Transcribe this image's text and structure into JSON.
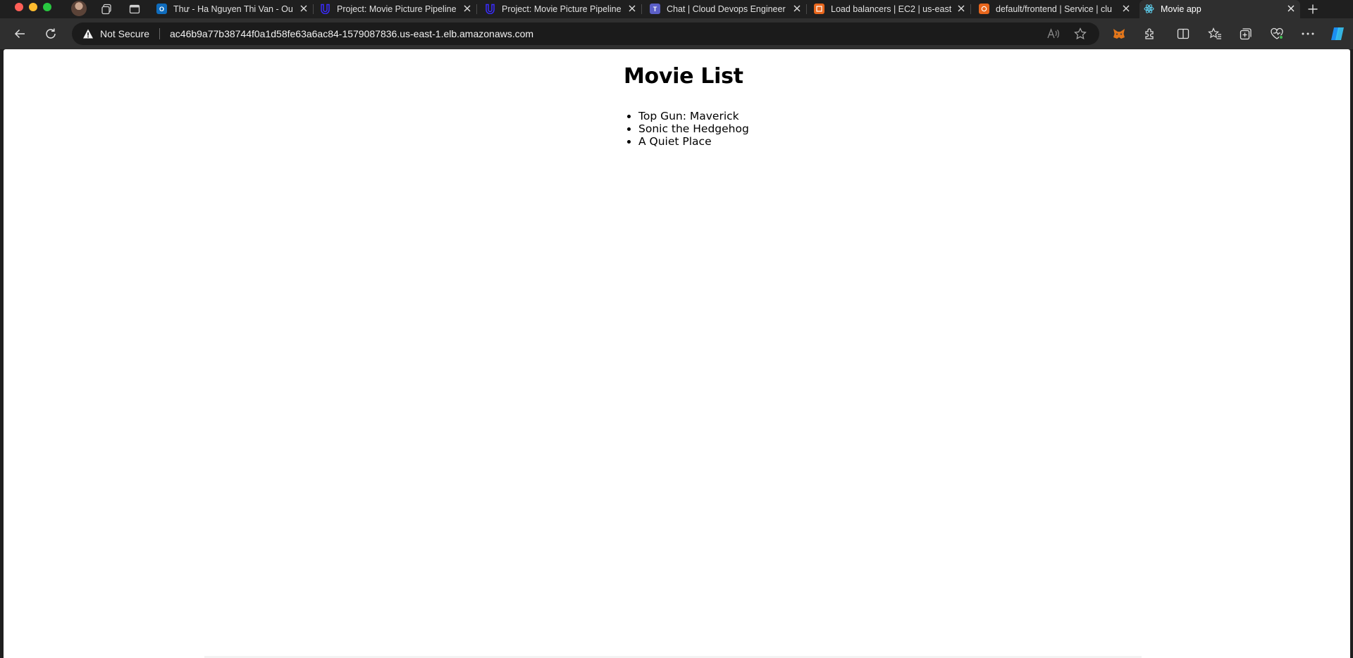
{
  "browser": {
    "tabs": [
      {
        "title": "Thư - Ha Nguyen Thi Van - Ou",
        "favicon": "outlook-icon",
        "color": "#0f6cbd"
      },
      {
        "title": "Project: Movie Picture Pipeline",
        "favicon": "udacity-icon",
        "color": "#2015ff"
      },
      {
        "title": "Project: Movie Picture Pipeline",
        "favicon": "udacity-icon",
        "color": "#2015ff"
      },
      {
        "title": "Chat | Cloud Devops Engineer",
        "favicon": "teams-icon",
        "color": "#5b5fc7"
      },
      {
        "title": "Load balancers | EC2 | us-east",
        "favicon": "aws-ec2-icon",
        "color": "#e8661c"
      },
      {
        "title": "default/frontend | Service | clu",
        "favicon": "aws-eks-icon",
        "color": "#e8661c"
      },
      {
        "title": "Movie app",
        "favicon": "react-icon",
        "color": "#61dafb",
        "active": true
      }
    ],
    "security_label": "Not Secure",
    "url": "ac46b9a77b38744f0a1d58fe63a6ac84-1579087836.us-east-1.elb.amazonaws.com"
  },
  "page": {
    "heading": "Movie List",
    "movies": [
      "Top Gun: Maverick",
      "Sonic the Hedgehog",
      "A Quiet Place"
    ]
  }
}
